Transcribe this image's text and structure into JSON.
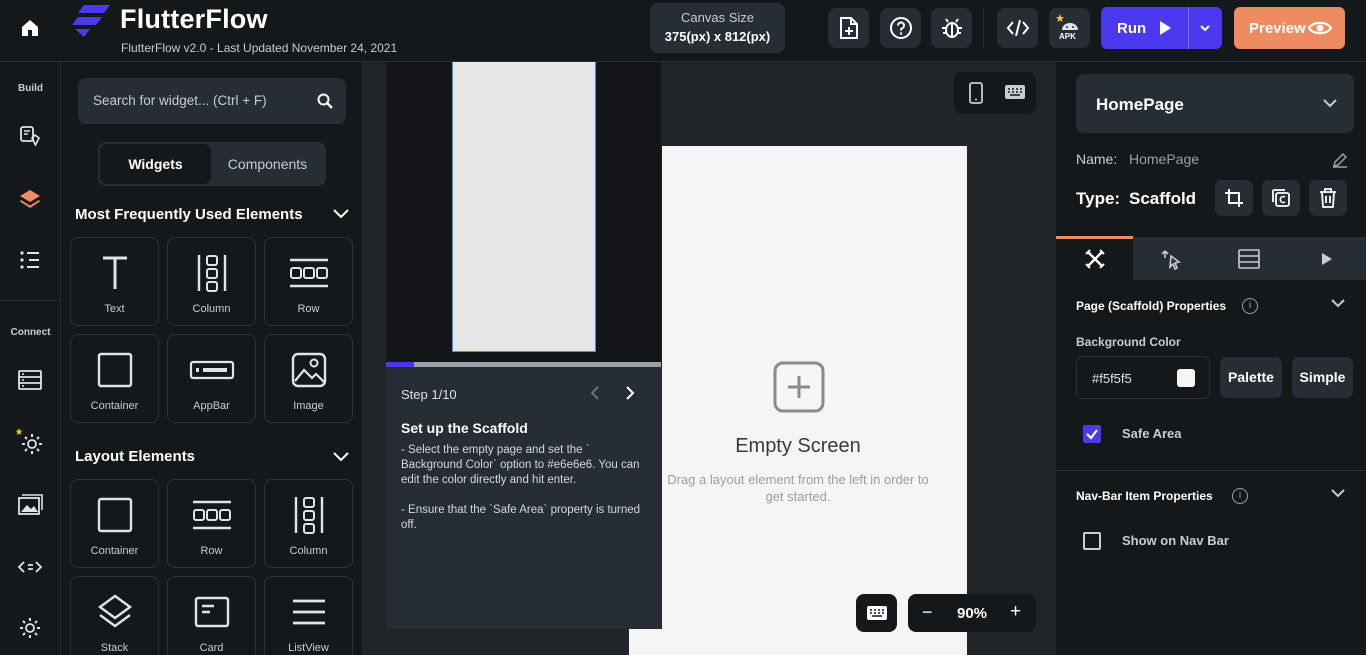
{
  "header": {
    "app_title": "FlutterFlow",
    "subtitle": "FlutterFlow v2.0 - Last Updated November 24, 2021",
    "canvas_size_label": "Canvas Size",
    "canvas_size_value": "375(px) x 812(px)",
    "apk_badge": "APK",
    "run_label": "Run",
    "preview_label": "Preview",
    "colors": {
      "run": "#4b39ef",
      "preview": "#ee8b60"
    }
  },
  "rail": {
    "build_label": "Build",
    "connect_label": "Connect",
    "icons": [
      "home-icon",
      "theme-icon",
      "layers-icon",
      "tree-icon",
      "database-icon",
      "settings-star-icon",
      "media-icon",
      "code-icon",
      "gear-icon"
    ]
  },
  "widget_panel": {
    "search_placeholder": "Search for widget... (Ctrl + F)",
    "seg_widgets": "Widgets",
    "seg_components": "Components",
    "section1_title": "Most Frequently Used Elements",
    "section1_items": [
      "Text",
      "Column",
      "Row",
      "Container",
      "AppBar",
      "Image"
    ],
    "section2_title": "Layout Elements",
    "section2_items": [
      "Container",
      "Row",
      "Column",
      "Stack",
      "Card",
      "ListView"
    ]
  },
  "tutorial": {
    "step": "Step 1/10",
    "title": "Set up the Scaffold",
    "text": "- Select the empty page and set the ` Background Color` option to #e6e6e6. You can edit the color directly and hit enter.\n\n- Ensure that the `Safe Area` property is turned off.",
    "progress": 0.1
  },
  "canvas": {
    "empty_title": "Empty Screen",
    "empty_subtitle": "Drag a layout element from the left in order to get started.",
    "zoom_minus": "−",
    "zoom_value": "90%",
    "zoom_plus": "+"
  },
  "properties": {
    "page_name": "HomePage",
    "name_label": "Name:",
    "name_value": "HomePage",
    "type_label": "Type:",
    "type_value": "Scaffold",
    "page_props_title": "Page (Scaffold) Properties",
    "bg_color_label": "Background Color",
    "bg_color_value": "#f5f5f5",
    "palette_label": "Palette",
    "simple_label": "Simple",
    "safe_area_label": "Safe Area",
    "safe_area_checked": true,
    "nav_props_title": "Nav-Bar Item Properties",
    "show_nav_label": "Show on Nav Bar",
    "show_nav_checked": false,
    "info_glyph": "i"
  }
}
